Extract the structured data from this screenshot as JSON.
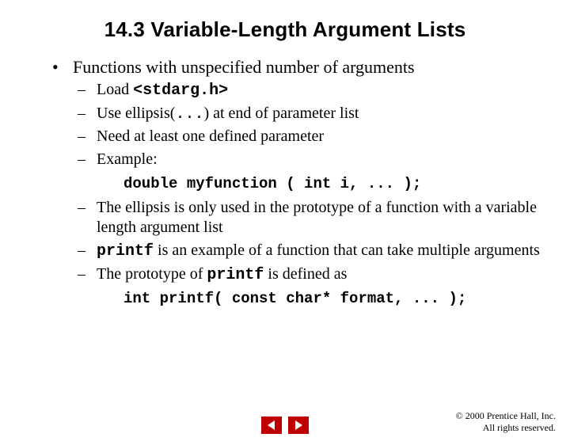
{
  "title": "14.3   Variable-Length Argument Lists",
  "bullet1": {
    "text": "Functions with unspecified number of arguments",
    "subs": [
      {
        "pre": "Load ",
        "code": "<stdarg.h>",
        "post": ""
      },
      {
        "pre": "Use ellipsis(",
        "code": "...",
        "post": ") at end of parameter list"
      },
      {
        "pre": "Need at least one defined parameter"
      },
      {
        "pre": "Example:"
      }
    ],
    "code1": "double myfunction ( int i, ... );",
    "subs2": [
      {
        "pre": "The ellipsis is only used in the prototype of a function with a variable length argument list"
      },
      {
        "code_a": "printf",
        "mid": " is an example of a function that can take multiple arguments"
      },
      {
        "pre": "The prototype of ",
        "code_a": "printf",
        "post": " is defined as"
      }
    ],
    "code2": "int printf( const char* format, ... );"
  },
  "copyright": {
    "sym": "©",
    "line1": " 2000 Prentice Hall, Inc.",
    "line2": "All rights reserved."
  }
}
